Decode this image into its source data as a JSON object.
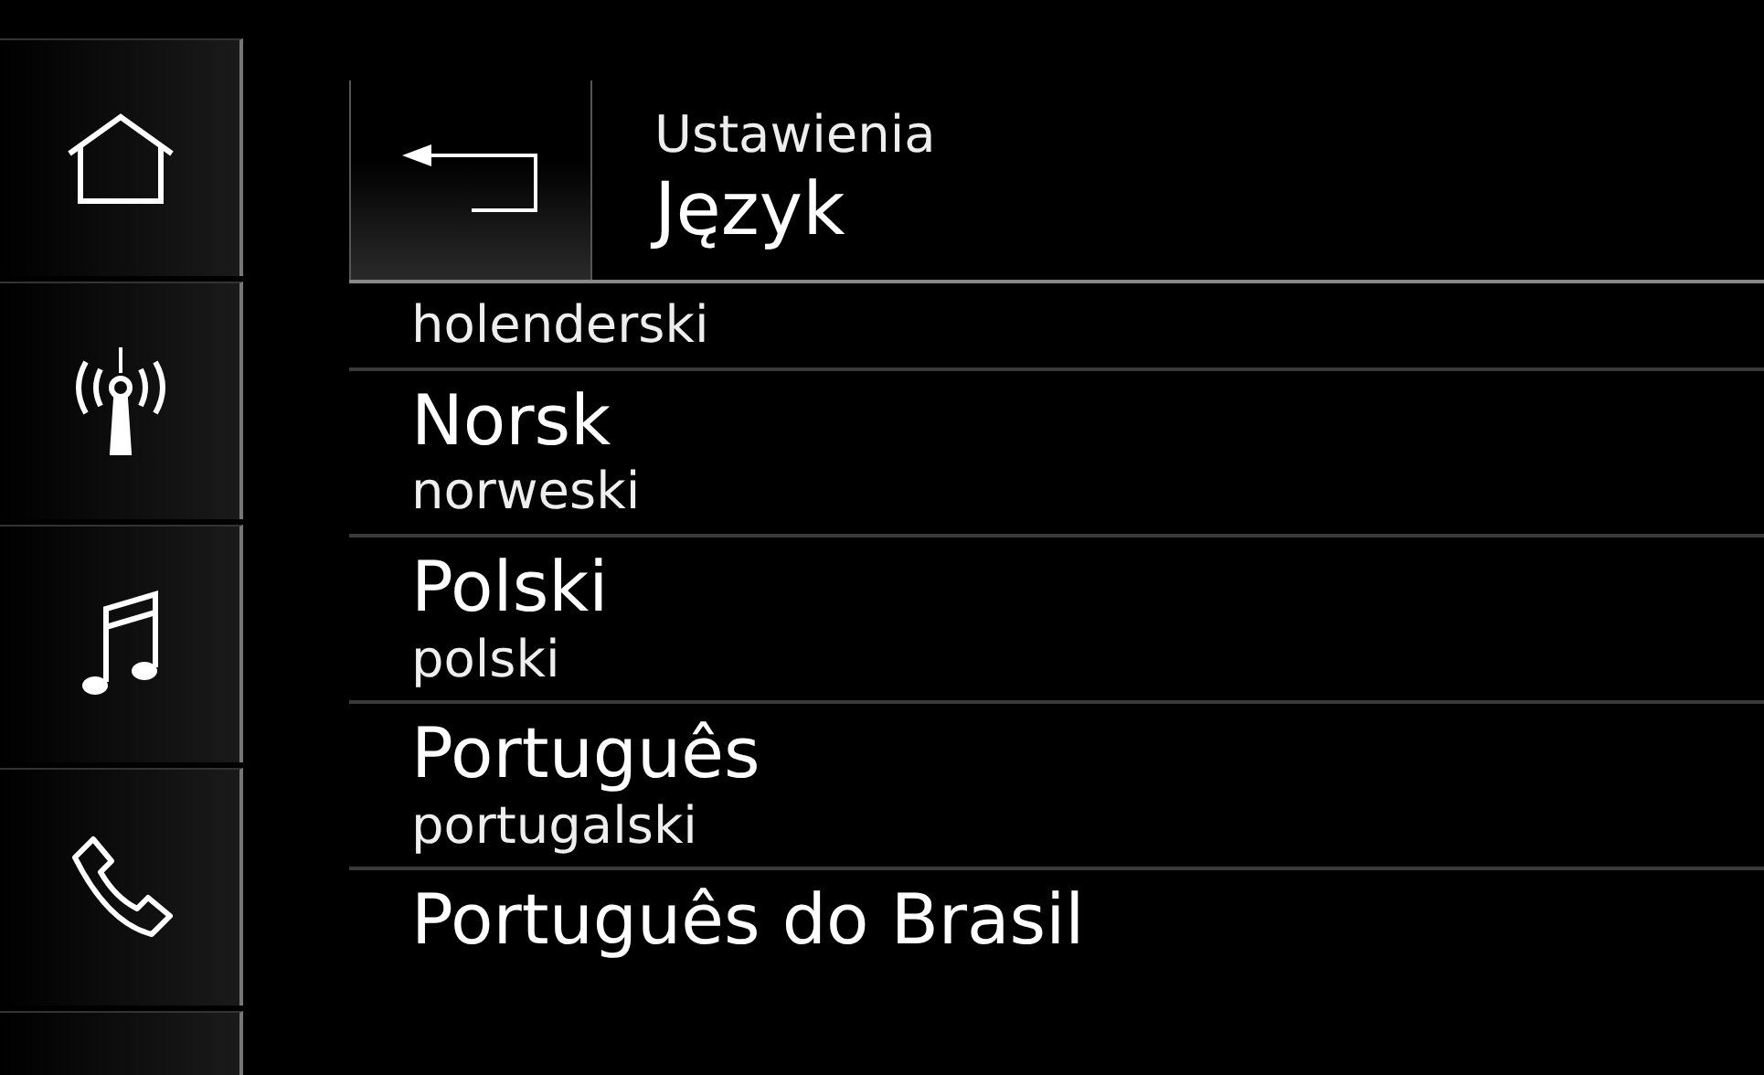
{
  "sidebar": {
    "items": [
      {
        "kind": "home"
      },
      {
        "kind": "radio"
      },
      {
        "kind": "music"
      },
      {
        "kind": "phone"
      },
      {
        "kind": "blank"
      }
    ]
  },
  "header": {
    "breadcrumb": "Ustawienia",
    "title": "Język"
  },
  "languages": [
    {
      "translation": "holenderski"
    },
    {
      "name": "Norsk",
      "translation": "norweski"
    },
    {
      "name": "Polski",
      "translation": "polski"
    },
    {
      "name": "Português",
      "translation": "portugalski"
    },
    {
      "name": "Português do Brasil"
    }
  ]
}
